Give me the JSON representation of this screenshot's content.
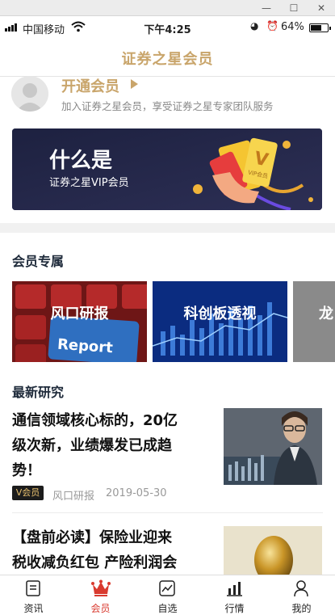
{
  "status_bar": {
    "carrier": "中国移动",
    "time": "下午4:25",
    "battery": "64%",
    "battery_level": 0.64
  },
  "nav": {
    "title": "证券之星会员"
  },
  "member_prompt": {
    "title": "开通会员",
    "subtitle": "加入证券之星会员，享受证券之星专家团队服务"
  },
  "banner": {
    "headline": "什么是",
    "subline": "证券之星VIP会员",
    "card_text": "V",
    "card_small": "VIP会员"
  },
  "exclusive": {
    "title": "会员专属",
    "cards": [
      {
        "label": "风口研报",
        "image_text": "Report"
      },
      {
        "label": "科创板透视"
      },
      {
        "label": "龙"
      }
    ]
  },
  "research": {
    "title": "最新研究",
    "articles": [
      {
        "title_lines": [
          "通信领域核心标的，20亿",
          "级次新，业绩爆发已成趋",
          "势！"
        ],
        "badge": "V会员",
        "source": "风口研报",
        "date": "2019-05-30"
      },
      {
        "title_lines": [
          "【盘前必读】保险业迎来",
          "税收减负红包 产险利润会"
        ]
      }
    ]
  },
  "tabbar": [
    {
      "label": "资讯",
      "icon": "news-icon"
    },
    {
      "label": "会员",
      "icon": "crown-icon",
      "active": true
    },
    {
      "label": "自选",
      "icon": "chart-line-icon"
    },
    {
      "label": "行情",
      "icon": "bar-chart-icon"
    },
    {
      "label": "我的",
      "icon": "user-icon"
    }
  ],
  "colors": {
    "accent_gold": "#c9a56b",
    "active_red": "#d93a2f",
    "banner_bg": "#222645"
  }
}
